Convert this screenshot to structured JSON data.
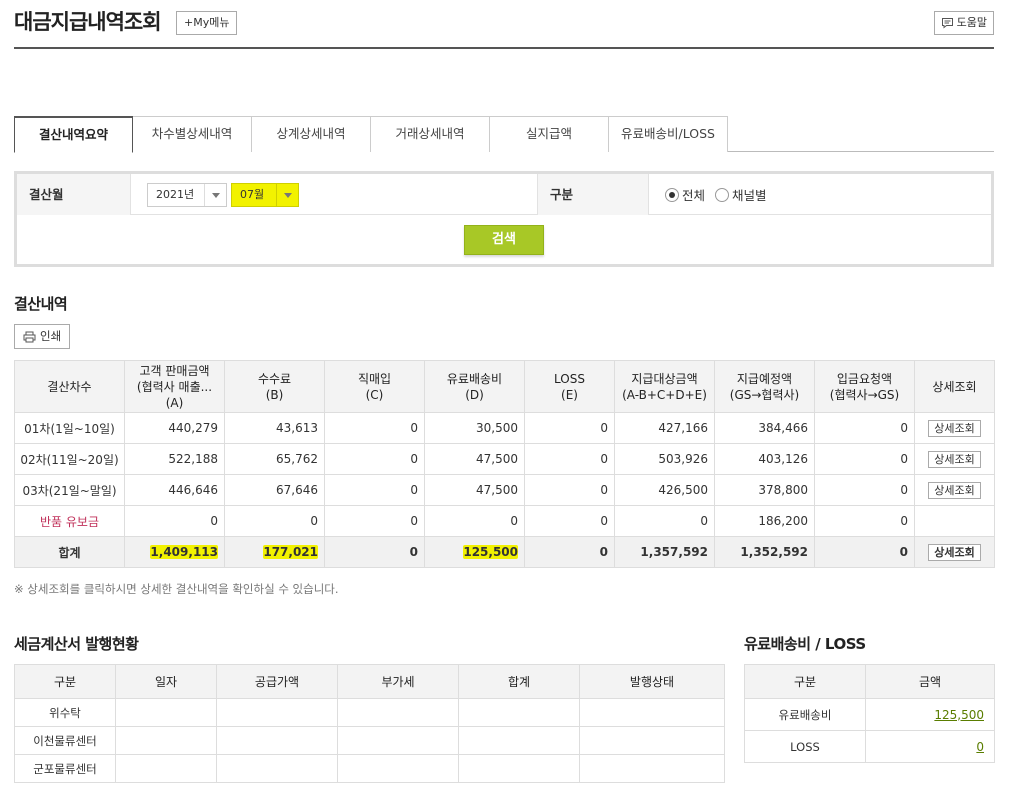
{
  "header": {
    "title": "대금지급내역조회",
    "mymenu_label": "My메뉴",
    "help_label": "도움말"
  },
  "tabs": [
    {
      "label": "결산내역요약",
      "active": true
    },
    {
      "label": "차수별상세내역",
      "active": false
    },
    {
      "label": "상계상세내역",
      "active": false
    },
    {
      "label": "거래상세내역",
      "active": false
    },
    {
      "label": "실지급액",
      "active": false
    },
    {
      "label": "유료배송비/LOSS",
      "active": false
    }
  ],
  "search": {
    "month_label": "결산월",
    "year_value": "2021년",
    "month_value": "07월",
    "type_label": "구분",
    "radio_all": "전체",
    "radio_channel": "채널별",
    "search_button": "검색"
  },
  "settlement": {
    "title": "결산내역",
    "print_label": "인쇄",
    "headers": [
      [
        "결산차수"
      ],
      [
        "고객 판매금액",
        "(협력사 매출...",
        "(A)"
      ],
      [
        "수수료",
        "(B)"
      ],
      [
        "직매입",
        "(C)"
      ],
      [
        "유료배송비",
        "(D)"
      ],
      [
        "LOSS",
        "(E)"
      ],
      [
        "지급대상금액",
        "(A-B+C+D+E)"
      ],
      [
        "지급예정액",
        "(GS→협력사)"
      ],
      [
        "입금요청액",
        "(협력사→GS)"
      ],
      [
        "상세조회"
      ]
    ],
    "rows": [
      {
        "label": "01차(1일~10일)",
        "a": "440,279",
        "b": "43,613",
        "c": "0",
        "d": "30,500",
        "e": "0",
        "target": "427,166",
        "pay": "384,466",
        "req": "0",
        "detail": "상세조회"
      },
      {
        "label": "02차(11일~20일)",
        "a": "522,188",
        "b": "65,762",
        "c": "0",
        "d": "47,500",
        "e": "0",
        "target": "503,926",
        "pay": "403,126",
        "req": "0",
        "detail": "상세조회"
      },
      {
        "label": "03차(21일~말일)",
        "a": "446,646",
        "b": "67,646",
        "c": "0",
        "d": "47,500",
        "e": "0",
        "target": "426,500",
        "pay": "378,800",
        "req": "0",
        "detail": "상세조회"
      },
      {
        "label": "반품 유보금",
        "a": "0",
        "b": "0",
        "c": "0",
        "d": "0",
        "e": "0",
        "target": "0",
        "pay": "186,200",
        "req": "0",
        "detail": ""
      }
    ],
    "total": {
      "label": "합계",
      "a": "1,409,113",
      "b": "177,021",
      "c": "0",
      "d": "125,500",
      "e": "0",
      "target": "1,357,592",
      "pay": "1,352,592",
      "req": "0",
      "detail": "상세조회"
    },
    "note": "※ 상세조회를 클릭하시면 상세한 결산내역을 확인하실 수 있습니다."
  },
  "tax_invoice": {
    "title": "세금계산서 발행현황",
    "headers": [
      "구분",
      "일자",
      "공급가액",
      "부가세",
      "합계",
      "발행상태"
    ],
    "rows": [
      "위수탁",
      "이천물류센터",
      "군포물류센터"
    ]
  },
  "delivery_loss": {
    "title": "유료배송비 / LOSS",
    "headers": [
      "구분",
      "금액"
    ],
    "rows": [
      {
        "label": "유료배송비",
        "amount": "125,500"
      },
      {
        "label": "LOSS",
        "amount": "0"
      }
    ]
  },
  "colors": {
    "highlight": "#f2f200",
    "search_button": "#a8c826",
    "link": "#5a7d00",
    "return_label": "#c0305a"
  }
}
